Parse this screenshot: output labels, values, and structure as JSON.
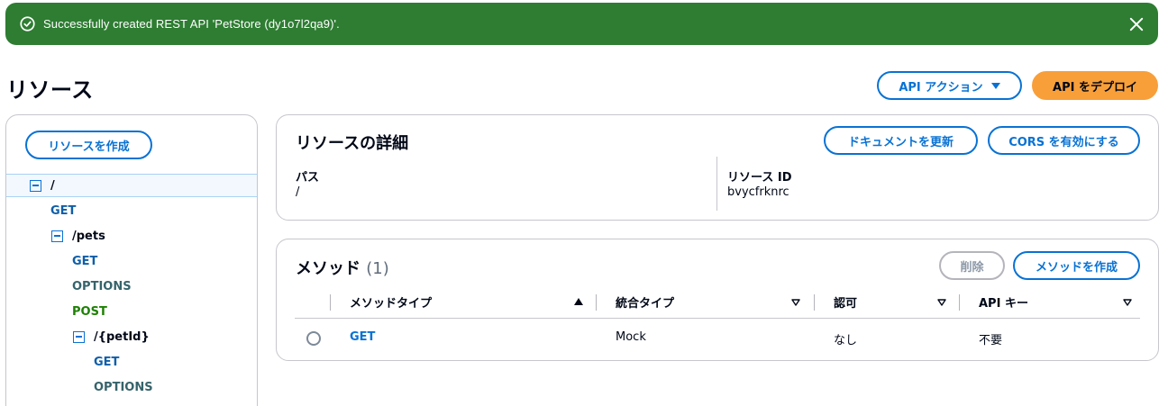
{
  "flash": {
    "message": "Successfully created REST API 'PetStore (dy1o7l2qa9)'.",
    "color": "#2e7d32"
  },
  "header": {
    "title": "リソース",
    "api_actions_label": "API アクション",
    "deploy_label": "API をデプロイ"
  },
  "sidebar": {
    "create_resource_label": "リソースを作成",
    "tree": [
      {
        "kind": "resource",
        "label": "/"
      },
      {
        "kind": "method",
        "label": "GET"
      },
      {
        "kind": "resource",
        "label": "/pets"
      },
      {
        "kind": "method",
        "label": "GET"
      },
      {
        "kind": "method",
        "label": "OPTIONS"
      },
      {
        "kind": "method",
        "label": "POST"
      },
      {
        "kind": "resource",
        "label": "/{petId}"
      },
      {
        "kind": "method",
        "label": "GET"
      },
      {
        "kind": "method",
        "label": "OPTIONS"
      }
    ]
  },
  "resource_details": {
    "title": "リソースの詳細",
    "update_docs_label": "ドキュメントを更新",
    "enable_cors_label": "CORS を有効にする",
    "path_label": "パス",
    "path_value": "/",
    "resource_id_label": "リソース ID",
    "resource_id_value": "bvycfrknrc"
  },
  "methods": {
    "title": "メソッド",
    "count": "(1)",
    "delete_label": "削除",
    "create_label": "メソッドを作成",
    "columns": [
      "メソッドタイプ",
      "統合タイプ",
      "認可",
      "API キー"
    ],
    "rows": [
      {
        "method": "GET",
        "integration": "Mock",
        "authorization": "なし",
        "api_key": "不要"
      }
    ]
  },
  "colors": {
    "accent": "#0972d3",
    "deploy": "#f89f3a",
    "get": "#0f5ea8",
    "options": "#36636b",
    "post": "#1d8102"
  }
}
